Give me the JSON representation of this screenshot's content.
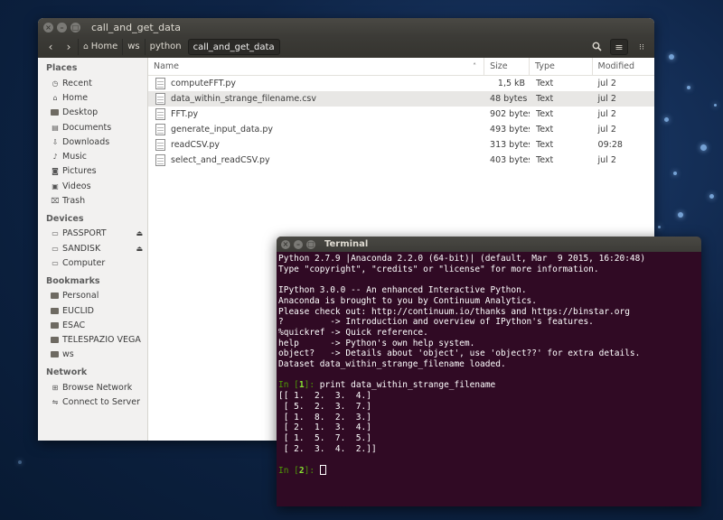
{
  "files_window": {
    "title": "call_and_get_data",
    "breadcrumbs": [
      "Home",
      "ws",
      "python",
      "call_and_get_data"
    ],
    "sidebar": {
      "sections": [
        {
          "heading": "Places",
          "items": [
            {
              "label": "Recent",
              "icon": "clock-icon"
            },
            {
              "label": "Home",
              "icon": "home-icon"
            },
            {
              "label": "Desktop",
              "icon": "folder-icon"
            },
            {
              "label": "Documents",
              "icon": "document-icon"
            },
            {
              "label": "Downloads",
              "icon": "download-icon"
            },
            {
              "label": "Music",
              "icon": "music-icon"
            },
            {
              "label": "Pictures",
              "icon": "camera-icon"
            },
            {
              "label": "Videos",
              "icon": "video-icon"
            },
            {
              "label": "Trash",
              "icon": "trash-icon"
            }
          ]
        },
        {
          "heading": "Devices",
          "items": [
            {
              "label": "PASSPORT",
              "icon": "drive-icon",
              "eject": true
            },
            {
              "label": "SANDISK",
              "icon": "drive-icon",
              "eject": true
            },
            {
              "label": "Computer",
              "icon": "drive-icon"
            }
          ]
        },
        {
          "heading": "Bookmarks",
          "items": [
            {
              "label": "Personal",
              "icon": "folder-icon"
            },
            {
              "label": "EUCLID",
              "icon": "folder-icon"
            },
            {
              "label": "ESAC",
              "icon": "folder-icon"
            },
            {
              "label": "TELESPAZIO VEGA",
              "icon": "folder-icon"
            },
            {
              "label": "ws",
              "icon": "folder-icon"
            }
          ]
        },
        {
          "heading": "Network",
          "items": [
            {
              "label": "Browse Network",
              "icon": "network-icon"
            },
            {
              "label": "Connect to Server",
              "icon": "server-icon"
            }
          ]
        }
      ]
    },
    "columns": {
      "name": "Name",
      "size": "Size",
      "type": "Type",
      "modified": "Modified"
    },
    "files": [
      {
        "name": "computeFFT.py",
        "size": "1,5 kB",
        "type": "Text",
        "modified": "jul 2"
      },
      {
        "name": "data_within_strange_filename.csv",
        "size": "48 bytes",
        "type": "Text",
        "modified": "jul 2",
        "selected": true
      },
      {
        "name": "FFT.py",
        "size": "902 bytes",
        "type": "Text",
        "modified": "jul 2"
      },
      {
        "name": "generate_input_data.py",
        "size": "493 bytes",
        "type": "Text",
        "modified": "jul 2"
      },
      {
        "name": "readCSV.py",
        "size": "313 bytes",
        "type": "Text",
        "modified": "09:28"
      },
      {
        "name": "select_and_readCSV.py",
        "size": "403 bytes",
        "type": "Text",
        "modified": "jul 2"
      }
    ]
  },
  "terminal": {
    "title": "Terminal",
    "header_lines": [
      "Python 2.7.9 |Anaconda 2.2.0 (64-bit)| (default, Mar  9 2015, 16:20:48)",
      "Type \"copyright\", \"credits\" or \"license\" for more information.",
      "",
      "IPython 3.0.0 -- An enhanced Interactive Python.",
      "Anaconda is brought to you by Continuum Analytics.",
      "Please check out: http://continuum.io/thanks and https://binstar.org",
      "?         -> Introduction and overview of IPython's features.",
      "%quickref -> Quick reference.",
      "help      -> Python's own help system.",
      "object?   -> Details about 'object', use 'object??' for extra details.",
      "Dataset data_within_strange_filename loaded.",
      ""
    ],
    "prompt1": {
      "pre": "In [",
      "num": "1",
      "post": "]: ",
      "command": "print data_within_strange_filename"
    },
    "output_lines": [
      "[[ 1.  2.  3.  4.]",
      " [ 5.  2.  3.  7.]",
      " [ 1.  8.  2.  3.]",
      " [ 2.  1.  3.  4.]",
      " [ 1.  5.  7.  5.]",
      " [ 2.  3.  4.  2.]]",
      ""
    ],
    "prompt2": {
      "pre": "In [",
      "num": "2",
      "post": "]: "
    }
  }
}
